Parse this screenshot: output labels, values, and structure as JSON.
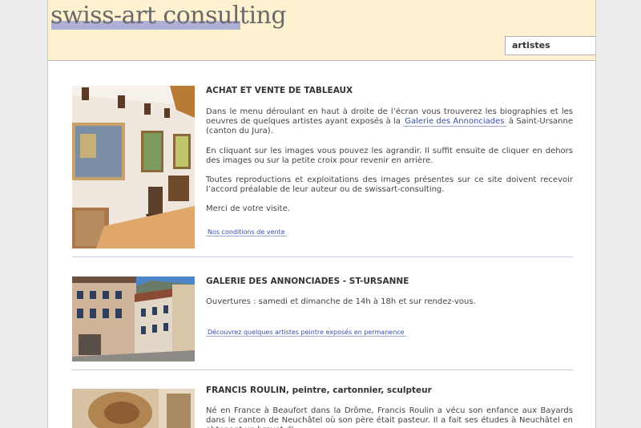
{
  "header": {
    "logo": "swiss-art consulting",
    "artist_select_value": "artistes"
  },
  "sections": [
    {
      "title": "ACHAT ET VENTE DE TABLEAUX",
      "p1_before": "Dans le menu déroulant en haut à droite de l’écran vous trouverez les biographies et les oeuvres de quelques artistes ayant exposés à la ",
      "p1_link": "Galerie des Annonciades",
      "p1_after": " à Saint-Ursanne (canton du Jura).",
      "p2": "En cliquant sur les images vous pouvez les agrandir. Il suffit ensuite de cliquer en dehors des images ou sur la petite croix pour revenir en arrière.",
      "p3": "Toutes reproductions et exploitations des images présentes sur ce site doivent recevoir l’accord préalable de leur auteur ou de swissart-consulting.",
      "p4": "Merci de votre visite.",
      "link": "Nos conditions de vente"
    },
    {
      "title": "GALERIE DES ANNONCIADES - ST-URSANNE",
      "p1": "Ouvertures : samedi et dimanche de 14h à 18h et sur rendez-vous.",
      "link": "Découvrez quelques artistes peintre exposés en permanence"
    },
    {
      "title": "FRANCIS ROULIN, peintre, cartonnier, sculpteur",
      "p1": "Né en France à Beaufort dans la Drôme, Francis Roulin a vécu son enfance aux Bayards dans le canton de Neuchâtel où son père était pasteur. Il a fait ses études à Neuchâtel en obtenant un brevet d’..."
    }
  ]
}
